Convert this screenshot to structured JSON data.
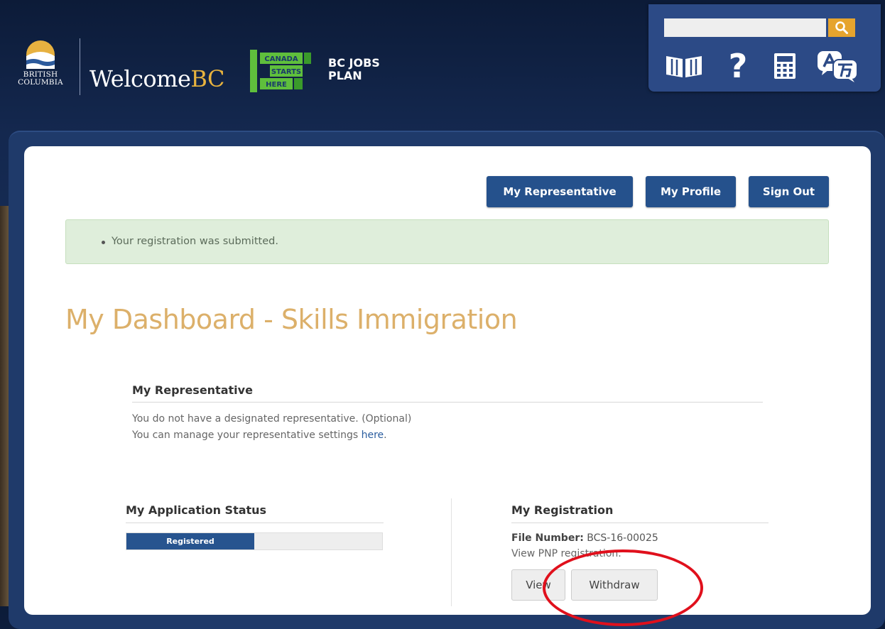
{
  "header": {
    "bc_logo_lines": [
      "BRITISH",
      "COLUMBIA"
    ],
    "welcome_prefix": "Welcome",
    "welcome_suffix": "BC",
    "canada_logo_lines": [
      "CANADA",
      "STARTS",
      "HERE"
    ],
    "bcjobs_lines": [
      "BC JOBS",
      "PLAN"
    ],
    "search": {
      "placeholder": ""
    },
    "tools": [
      {
        "icon": "book-icon"
      },
      {
        "icon": "help-icon",
        "glyph": "?"
      },
      {
        "icon": "calculator-icon"
      },
      {
        "icon": "translate-icon"
      }
    ]
  },
  "nav": {
    "my_representative": "My Representative",
    "my_profile": "My Profile",
    "sign_out": "Sign Out"
  },
  "alert": {
    "message": "Your registration was submitted."
  },
  "page_title": "My Dashboard - Skills Immigration",
  "representative": {
    "title": "My Representative",
    "line1": "You do not have a designated representative. (Optional)",
    "line2_prefix": "You can manage your representative settings ",
    "line2_link": "here",
    "line2_suffix": "."
  },
  "application_status": {
    "title": "My Application Status",
    "progress_label": "Registered",
    "progress_fraction": 0.5
  },
  "registration": {
    "title": "My Registration",
    "file_number_label": "File Number:",
    "file_number_value": "BCS-16-00025",
    "view_text": "View PNP registration.",
    "view_button": "View",
    "withdraw_button": "Withdraw"
  },
  "colors": {
    "nav_button": "#25518c",
    "title_gold": "#dcb06a",
    "alert_bg": "#dfeedb",
    "annotation_red": "#e0101c"
  }
}
